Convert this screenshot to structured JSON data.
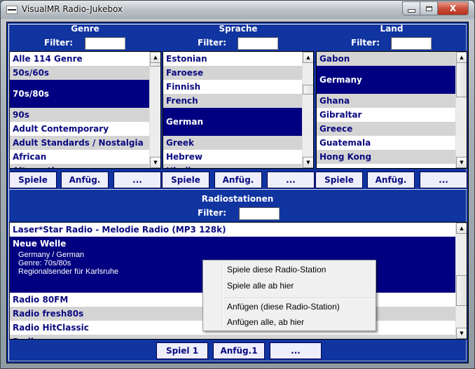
{
  "window": {
    "title": "VisualMR Radio-Jukebox",
    "controls": {
      "minimize": "minimize",
      "maximize": "maximize",
      "close": "X"
    }
  },
  "columns": [
    {
      "title": "Genre",
      "filter_label": "Filter:",
      "filter_value": "",
      "items": [
        {
          "label": "Alle 114 Genre",
          "state": "white"
        },
        {
          "label": "50s/60s",
          "state": "gray"
        },
        {
          "label": "70s/80s",
          "state": "selected"
        },
        {
          "label": "90s",
          "state": "gray"
        },
        {
          "label": "Adult Contemporary",
          "state": "white"
        },
        {
          "label": "Adult Standards / Nostalgia",
          "state": "gray"
        },
        {
          "label": "African",
          "state": "white"
        },
        {
          "label": "Alternative",
          "state": "gray"
        }
      ],
      "buttons": [
        "Spiele",
        "Anfüg.",
        "..."
      ]
    },
    {
      "title": "Sprache",
      "filter_label": "Filter:",
      "filter_value": "",
      "items": [
        {
          "label": "Estonian",
          "state": "white"
        },
        {
          "label": "Faroese",
          "state": "gray"
        },
        {
          "label": "Finnish",
          "state": "white"
        },
        {
          "label": "French",
          "state": "gray"
        },
        {
          "label": "German",
          "state": "selected"
        },
        {
          "label": "Greek",
          "state": "gray"
        },
        {
          "label": "Hebrew",
          "state": "white"
        },
        {
          "label": "Hindi",
          "state": "gray"
        }
      ],
      "buttons": [
        "Spiele",
        "Anfüg.",
        "..."
      ]
    },
    {
      "title": "Land",
      "filter_label": "Filter:",
      "filter_value": "",
      "items": [
        {
          "label": "Gabon",
          "state": "gray"
        },
        {
          "label": "Germany",
          "state": "selected"
        },
        {
          "label": "Ghana",
          "state": "gray"
        },
        {
          "label": "Gibraltar",
          "state": "white"
        },
        {
          "label": "Greece",
          "state": "gray"
        },
        {
          "label": "Guatemala",
          "state": "white"
        },
        {
          "label": "Hong Kong",
          "state": "gray"
        },
        {
          "label": "",
          "state": "white"
        }
      ],
      "buttons": [
        "Spiele",
        "Anfüg.",
        "..."
      ]
    }
  ],
  "stations": {
    "title": "Radiostationen",
    "filter_label": "Filter:",
    "filter_value": "",
    "items": [
      {
        "name": "Laser*Star Radio - Melodie Radio (MP3 128k)",
        "state": "white"
      },
      {
        "name": "Neue Welle",
        "state": "selected",
        "details": [
          "Germany / German",
          "Genre: 70s/80s",
          "Regionalsender für Karlsruhe"
        ]
      },
      {
        "name": "Radio 80FM",
        "state": "white"
      },
      {
        "name": "Radio fresh80s",
        "state": "gray"
      },
      {
        "name": "Radio HitClassic",
        "state": "white"
      },
      {
        "name": "Radio ...",
        "state": "gray"
      }
    ],
    "buttons": [
      "Spiel 1",
      "Anfüg.1",
      "..."
    ]
  },
  "context_menu": {
    "items": [
      "Spiele diese Radio-Station",
      "Spiele alle ab hier",
      "Anfügen (diese Radio-Station)",
      "Anfügen alle, ab hier"
    ]
  },
  "colors": {
    "panel_bg": "#1034a0",
    "selection": "#000080",
    "row_text": "#0a0a80",
    "row_alt": "#d4d4d4",
    "button_bg": "#eeeefc"
  }
}
